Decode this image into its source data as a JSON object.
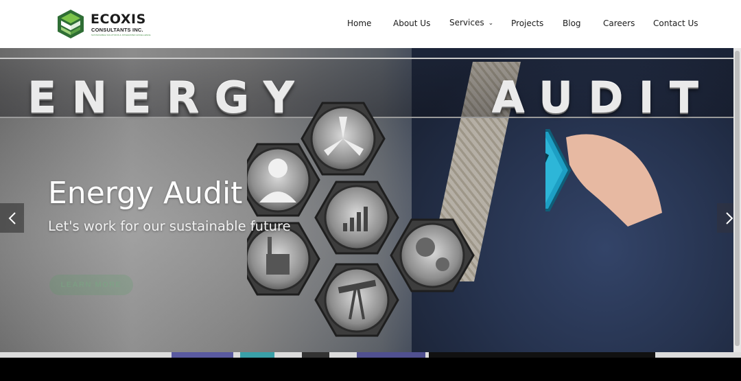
{
  "brand": {
    "name": "ECOXIS",
    "subtitle": "CONSULTANTS INC.",
    "tagline": "SUSTAINABLE SOLUTIONS & INTEGRATED EXCELLENCE",
    "colors": {
      "green": "#3f8f3f",
      "dark": "#1c1c1c",
      "accent": "#6fbf4a"
    }
  },
  "nav": {
    "items": [
      {
        "label": "Home"
      },
      {
        "label": "About Us"
      },
      {
        "label": "Services",
        "icon": "chevron-down-icon"
      },
      {
        "label": "Projects"
      },
      {
        "label": "Blog"
      },
      {
        "label": "Careers"
      },
      {
        "label": "Contact Us"
      }
    ]
  },
  "hero": {
    "banner_text": "ENERGY AUDIT",
    "title": "Energy Audit",
    "subtitle": "Let's work for our sustainable future",
    "button_label": "LEARN MORE",
    "prev_icon": "chevron-left-icon",
    "next_icon": "chevron-right-icon"
  }
}
